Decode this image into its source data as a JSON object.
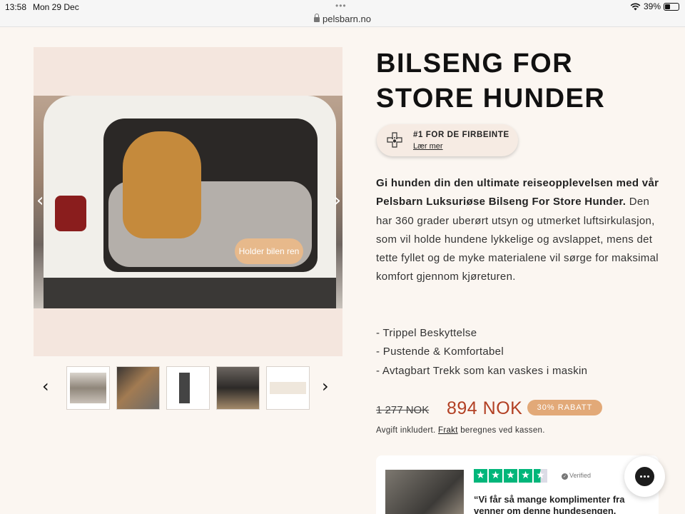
{
  "status_bar": {
    "time": "13:58",
    "date": "Mon 29 Dec",
    "url": "pelsbarn.no",
    "battery": "39%",
    "battery_level": 0.39
  },
  "gallery": {
    "image_pill": "Holder bilen ren",
    "thumbnail_count": 5
  },
  "product": {
    "title_line1": "BILSENG FOR",
    "title_line2": "STORE HUNDER",
    "badge_title": "#1 FOR DE FIRBEINTE",
    "badge_link": "Lær mer",
    "description_bold": "Gi hunden din den ultimate reiseopplevelsen med vår Pelsbarn Luksuriøse Bilseng For Store Hunder.",
    "description_rest": " Den har 360 grader uberørt utsyn og utmerket luftsirkulasjon, som vil holde hundene lykkelige og avslappet, mens det tette fyllet og de myke materialene vil sørge for maksimal komfort gjennom kjøreturen.",
    "features": [
      "- Trippel Beskyttelse",
      "- Pustende & Komfortabel",
      "- Avtagbart Trekk som kan vaskes i maskin"
    ],
    "old_price": "1 277 NOK",
    "new_price": "894 NOK",
    "discount": "30% RABATT",
    "tax_before": "Avgift inkludert. ",
    "tax_link": "Frakt",
    "tax_after": " beregnes ved kassen."
  },
  "review": {
    "rating": 4.5,
    "verified": "Verified",
    "text": "“Vi får så mange komplimenter fra venner om denne hundesengen. Fantastisk god"
  },
  "colors": {
    "background": "#fbf6f1",
    "price_accent": "#b24024",
    "discount_badge": "#e2a978",
    "trustpilot_green": "#00b67a"
  }
}
